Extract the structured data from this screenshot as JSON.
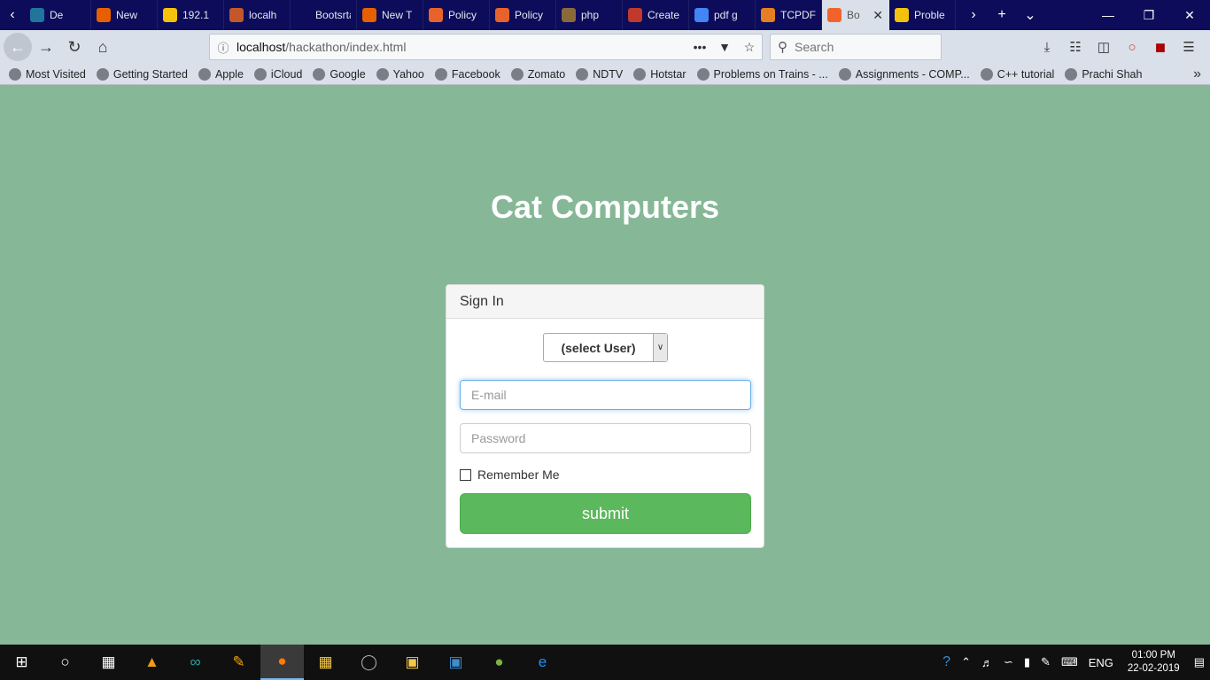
{
  "browser": {
    "tabs": [
      {
        "label": "De",
        "icon": "wordpress-icon",
        "color": "#21759b"
      },
      {
        "label": "New",
        "icon": "firefox-icon",
        "color": "#e66000"
      },
      {
        "label": "192.1",
        "icon": "warning-icon",
        "color": "#f4c20d"
      },
      {
        "label": "localh",
        "icon": "xampp-icon",
        "color": "#c4572a"
      },
      {
        "label": "Bootsrtap",
        "icon": "blank-icon",
        "color": "#0c0c5a"
      },
      {
        "label": "New T",
        "icon": "firefox-icon",
        "color": "#e66000"
      },
      {
        "label": "Policy",
        "icon": "swoosh-icon",
        "color": "#e8632b"
      },
      {
        "label": "Policy",
        "icon": "swoosh-icon",
        "color": "#e8632b"
      },
      {
        "label": "php",
        "icon": "php-icon",
        "color": "#8a6a3a"
      },
      {
        "label": "Create",
        "icon": "dm-icon",
        "color": "#c0392b"
      },
      {
        "label": "pdf g",
        "icon": "google-icon",
        "color": "#4285f4"
      },
      {
        "label": "TCPDF",
        "icon": "tcpdf-icon",
        "color": "#e67e22"
      },
      {
        "label": "Bo",
        "icon": "bootstrap-icon",
        "color": "#f0642b",
        "active": true
      },
      {
        "label": "Proble",
        "icon": "warning-icon",
        "color": "#f4c20d"
      }
    ],
    "url_host": "localhost",
    "url_path": "/hackathon/index.html",
    "search_placeholder": "Search",
    "bookmarks": [
      {
        "label": "Most Visited",
        "icon": "gear-icon"
      },
      {
        "label": "Getting Started",
        "icon": "firefox-icon"
      },
      {
        "label": "Apple",
        "icon": "apple-icon"
      },
      {
        "label": "iCloud",
        "icon": "apple-icon"
      },
      {
        "label": "Google",
        "icon": "google-icon"
      },
      {
        "label": "Yahoo",
        "icon": "globe-icon"
      },
      {
        "label": "Facebook",
        "icon": "globe-icon"
      },
      {
        "label": "Zomato",
        "icon": "globe-icon"
      },
      {
        "label": "NDTV",
        "icon": "globe-icon"
      },
      {
        "label": "Hotstar",
        "icon": "globe-icon"
      },
      {
        "label": "Problems on Trains - ...",
        "icon": "globe-icon"
      },
      {
        "label": "Assignments - COMP...",
        "icon": "globe-icon"
      },
      {
        "label": "C++ tutorial",
        "icon": "cpp-icon"
      },
      {
        "label": "Prachi Shah",
        "icon": "globe-icon"
      }
    ]
  },
  "page": {
    "title": "Cat Computers",
    "panel_heading": "Sign In",
    "select_value": "(select User)",
    "email_placeholder": "E-mail",
    "password_placeholder": "Password",
    "remember_label": "Remember Me",
    "submit_label": "submit"
  },
  "taskbar": {
    "lang": "ENG",
    "time": "01:00 PM",
    "date": "22-02-2019"
  },
  "colors": {
    "page_bg": "#86b797",
    "submit_bg": "#5cb85c",
    "browser_frame": "#0c0c5a"
  }
}
